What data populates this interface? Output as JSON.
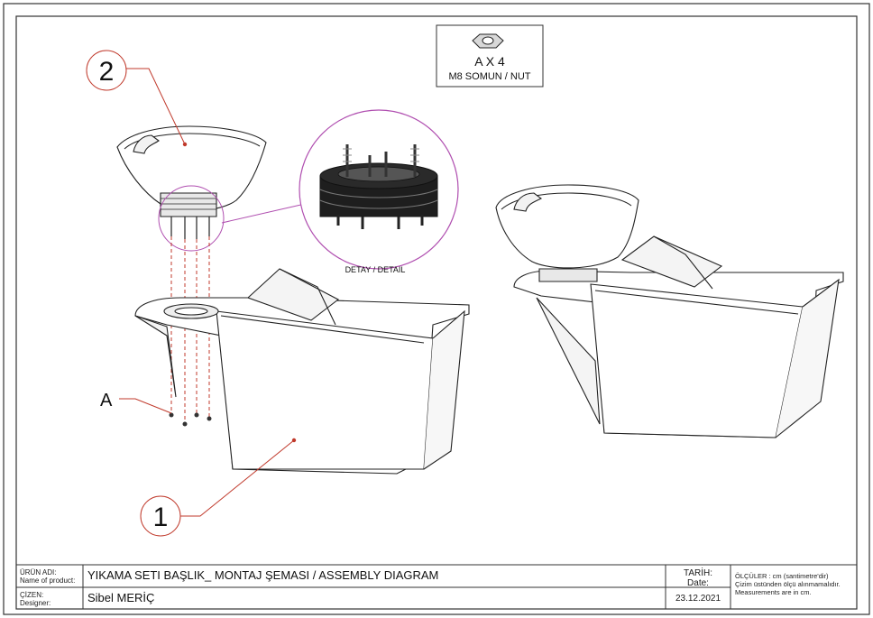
{
  "callouts": {
    "part1": "1",
    "part2": "2",
    "partA": "A"
  },
  "hardware_box": {
    "line1": "A X 4",
    "line2": "M8 SOMUN / NUT"
  },
  "detail_label": "DETAY / DETAIL",
  "title_block": {
    "product_label_1": "ÜRÜN ADI:",
    "product_label_2": "Name of product:",
    "product_value": "YIKAMA SETI BAŞLIK_ MONTAJ ŞEMASI / ASSEMBLY DIAGRAM",
    "designer_label_1": "ÇİZEN:",
    "designer_label_2": "Designer:",
    "designer_value": "Sibel MERİÇ",
    "date_label_1": "TARİH:",
    "date_label_2": "Date:",
    "date_value": "23.12.2021",
    "notes_1": "ÖLÇÜLER : cm (santimetre'dir)",
    "notes_2": "Çizim üstünden ölçü alınmamalıdır.",
    "notes_3": "Measurements are in cm."
  },
  "colors": {
    "line": "#1a1a1a",
    "callout": "#c0392b",
    "detail_circle": "#b04fb0"
  }
}
